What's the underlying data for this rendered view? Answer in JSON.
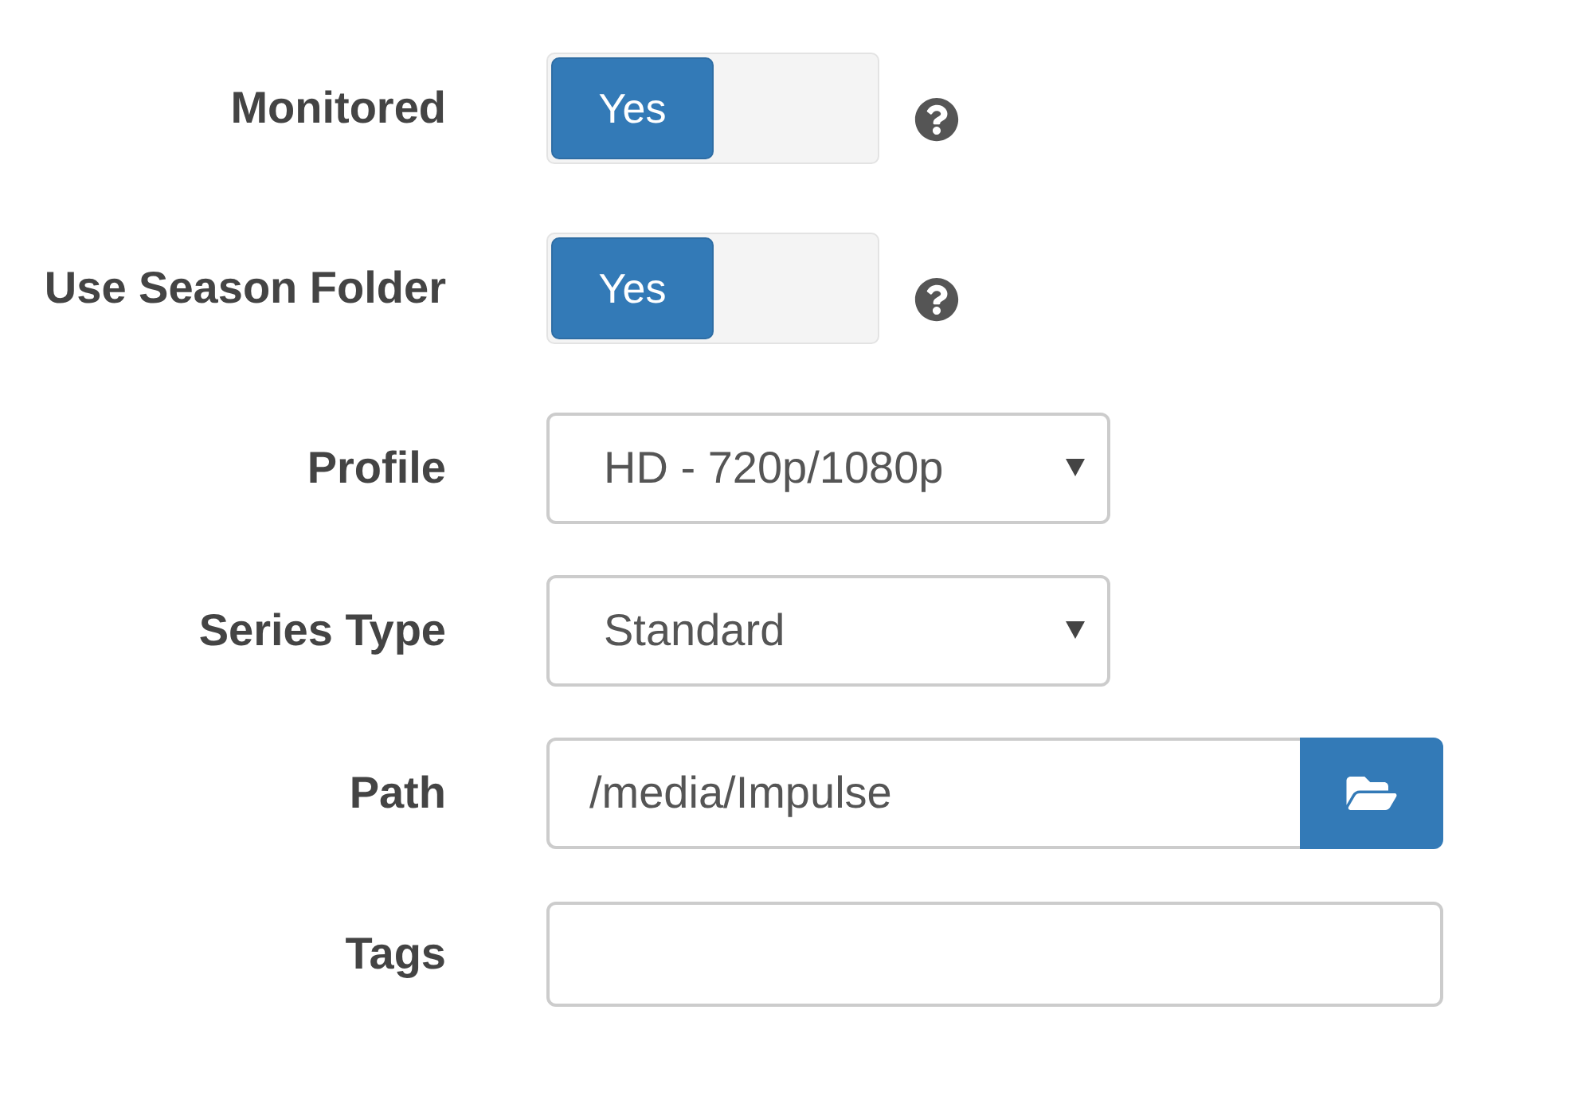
{
  "fields": [
    {
      "kind": "toggle",
      "label": "Monitored",
      "on": true,
      "toggle_label": "Yes"
    },
    {
      "kind": "toggle",
      "label": "Use Season Folder",
      "on": true,
      "toggle_label": "Yes"
    },
    {
      "kind": "select",
      "label": "Profile",
      "value": "HD - 720p/1080p"
    },
    {
      "kind": "select",
      "label": "Series Type",
      "value": "Standard"
    },
    {
      "kind": "path",
      "label": "Path",
      "value": "/media/Impulse"
    },
    {
      "kind": "text",
      "label": "Tags"
    }
  ]
}
